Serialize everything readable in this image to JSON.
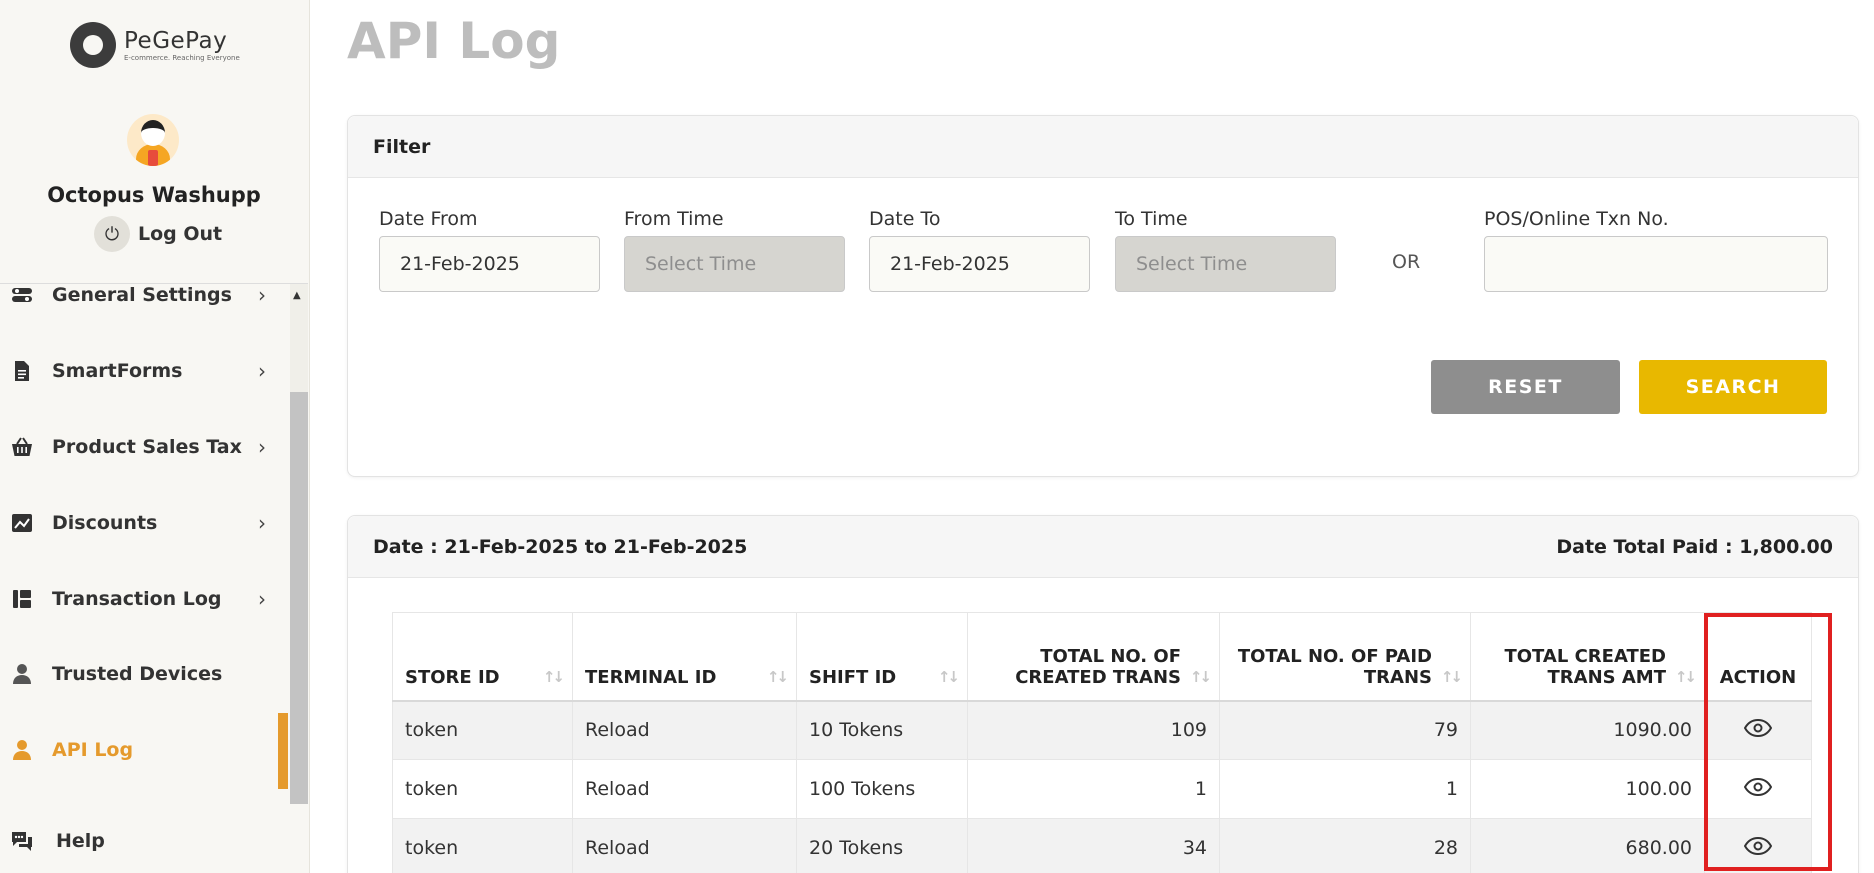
{
  "brand": {
    "name": "PeGePay",
    "tagline": "E-commerce. Reaching Everyone"
  },
  "user": {
    "name": "Octopus Washupp",
    "logout_label": "Log Out"
  },
  "sidebar": {
    "items": [
      {
        "label": "General Settings",
        "icon": "toggle-icon",
        "has_chevron": true
      },
      {
        "label": "SmartForms",
        "icon": "document-icon",
        "has_chevron": true
      },
      {
        "label": "Product Sales Tax",
        "icon": "basket-icon",
        "has_chevron": true
      },
      {
        "label": "Discounts",
        "icon": "chart-icon",
        "has_chevron": true
      },
      {
        "label": "Transaction Log",
        "icon": "list-icon",
        "has_chevron": true
      },
      {
        "label": "Trusted Devices",
        "icon": "user-icon",
        "has_chevron": false
      },
      {
        "label": "API Log",
        "icon": "user-icon",
        "has_chevron": false,
        "active": true
      },
      {
        "label": "Help",
        "icon": "chat-icon",
        "has_chevron": false
      }
    ]
  },
  "page": {
    "title": "API Log"
  },
  "filter": {
    "title": "Filter",
    "date_from": {
      "label": "Date From",
      "value": "21-Feb-2025"
    },
    "from_time": {
      "label": "From Time",
      "placeholder": "Select Time"
    },
    "date_to": {
      "label": "Date To",
      "value": "21-Feb-2025"
    },
    "to_time": {
      "label": "To Time",
      "placeholder": "Select Time"
    },
    "or_label": "OR",
    "txn_no": {
      "label": "POS/Online Txn No.",
      "value": ""
    },
    "reset_label": "RESET",
    "search_label": "SEARCH"
  },
  "results": {
    "date_range": "Date : 21-Feb-2025 to 21-Feb-2025",
    "total_paid": "Date Total Paid : 1,800.00",
    "columns": [
      "STORE ID",
      "TERMINAL ID",
      "SHIFT ID",
      "TOTAL NO. OF CREATED TRANS",
      "TOTAL NO. OF PAID TRANS",
      "TOTAL CREATED TRANS AMT",
      "ACTION"
    ],
    "rows": [
      {
        "store_id": "token",
        "terminal_id": "Reload",
        "shift_id": "10 Tokens",
        "created": "109",
        "paid": "79",
        "amount": "1090.00"
      },
      {
        "store_id": "token",
        "terminal_id": "Reload",
        "shift_id": "100 Tokens",
        "created": "1",
        "paid": "1",
        "amount": "100.00"
      },
      {
        "store_id": "token",
        "terminal_id": "Reload",
        "shift_id": "20 Tokens",
        "created": "34",
        "paid": "28",
        "amount": "680.00"
      }
    ]
  },
  "colors": {
    "accent": "#e59a2c",
    "search_button": "#e8b800",
    "reset_button": "#8e8e8e",
    "highlight": "#e02020"
  }
}
